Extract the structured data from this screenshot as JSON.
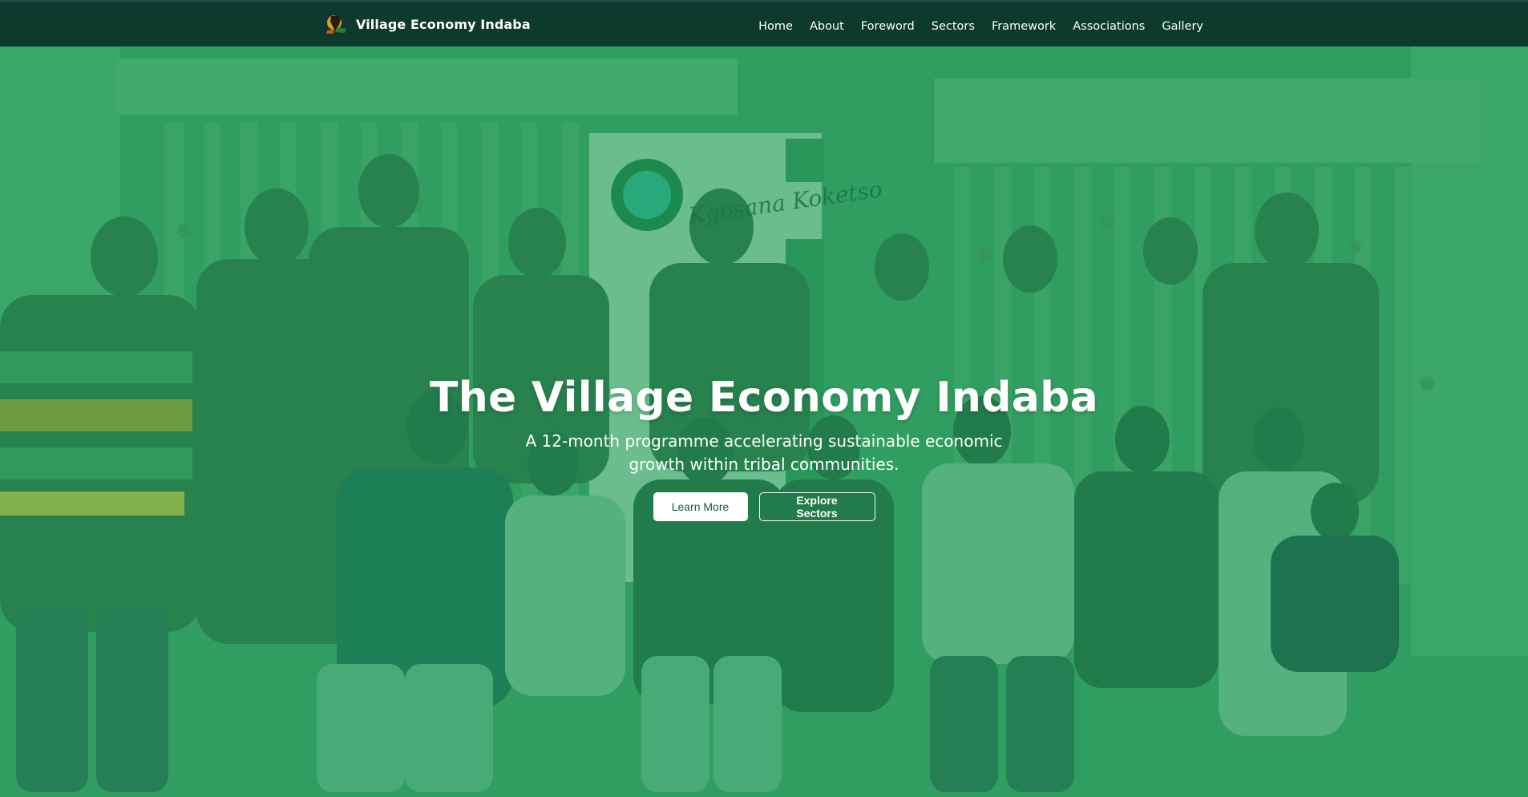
{
  "brand": {
    "name": "Village Economy Indaba",
    "logo_icon": "leaf-africa-logo-icon"
  },
  "nav": {
    "items": [
      {
        "label": "Home"
      },
      {
        "label": "About"
      },
      {
        "label": "Foreword"
      },
      {
        "label": "Sectors"
      },
      {
        "label": "Framework"
      },
      {
        "label": "Associations"
      },
      {
        "label": "Gallery"
      }
    ]
  },
  "hero": {
    "title": "The Village Economy Indaba",
    "subtitle": "A 12-month programme accelerating sustainable economic growth within tribal communities.",
    "banner_text": "Kgosana Koketso",
    "buttons": {
      "learn_more": "Learn More",
      "explore_sectors": "Explore Sectors"
    }
  },
  "colors": {
    "navbar": "#0d3a2c",
    "hero_tint": "#2f9b5d",
    "button_text": "#145a3c"
  }
}
